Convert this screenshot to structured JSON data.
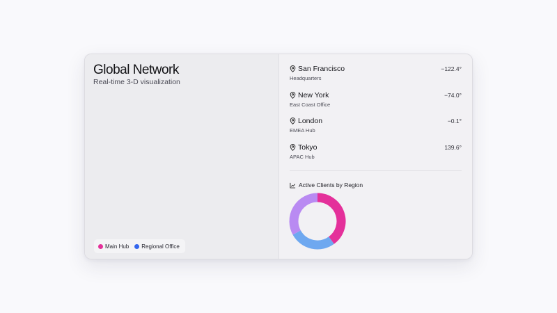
{
  "panel": {
    "title": "Global Network",
    "subtitle": "Real-time 3-D visualization"
  },
  "legend": [
    {
      "label": "Main Hub",
      "color": "#e4309a"
    },
    {
      "label": "Regional Office",
      "color": "#3366ee"
    }
  ],
  "locations": [
    {
      "name": "San Francisco",
      "subtitle": "Headquarters",
      "coord": "−122.4°",
      "icon": "map-pin-icon"
    },
    {
      "name": "New York",
      "subtitle": "East Coast Office",
      "coord": "−74.0°",
      "icon": "map-pin-icon"
    },
    {
      "name": "London",
      "subtitle": "EMEA Hub",
      "coord": "−0.1°",
      "icon": "map-pin-icon"
    },
    {
      "name": "Tokyo",
      "subtitle": "APAC Hub",
      "coord": "139.6°",
      "icon": "map-pin-icon"
    }
  ],
  "chart": {
    "title": "Active Clients by Region",
    "icon": "line-chart-icon"
  },
  "chart_data": {
    "type": "pie",
    "donut": true,
    "values": [
      40,
      27,
      33
    ],
    "colors": [
      "#e4309a",
      "#6ea8f0",
      "#b98af2"
    ]
  }
}
